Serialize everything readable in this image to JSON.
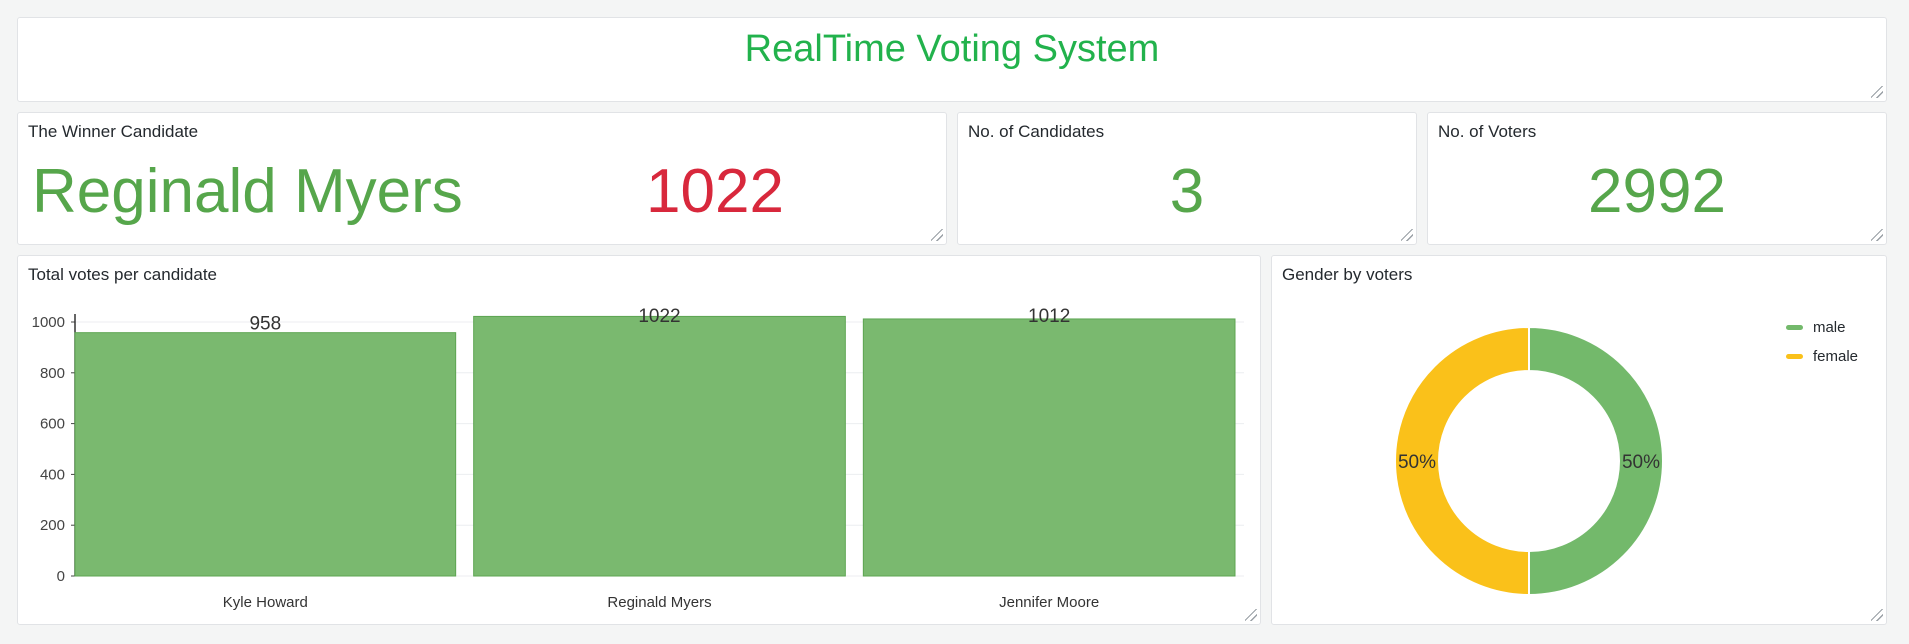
{
  "header": {
    "title": "RealTime Voting System"
  },
  "winner": {
    "title": "The Winner Candidate",
    "name": "Reginald Myers",
    "votes": "1022"
  },
  "candidates": {
    "title": "No. of Candidates",
    "value": "3"
  },
  "voters": {
    "title": "No. of Voters",
    "value": "2992"
  },
  "bar_panel": {
    "title": "Total votes per candidate"
  },
  "pie_panel": {
    "title": "Gender by voters"
  },
  "colors": {
    "green": "#56a64b",
    "red": "#d8283c",
    "title_green": "#22b24c",
    "yellow": "#fac11a"
  },
  "chart_data": [
    {
      "type": "bar",
      "categories": [
        "Kyle Howard",
        "Reginald Myers",
        "Jennifer Moore"
      ],
      "values": [
        958,
        1022,
        1012
      ],
      "title": "Total votes per candidate",
      "xlabel": "",
      "ylabel": "",
      "ylim": [
        0,
        1000
      ],
      "yticks": [
        0,
        200,
        400,
        600,
        800,
        1000
      ],
      "grid": true
    },
    {
      "type": "pie",
      "donut": true,
      "title": "Gender by voters",
      "labels": [
        "male",
        "female"
      ],
      "values": [
        50,
        50
      ],
      "value_labels": [
        "50%",
        "50%"
      ],
      "colors": [
        "#73b96b",
        "#fac11a"
      ],
      "legend": "top-right"
    }
  ]
}
